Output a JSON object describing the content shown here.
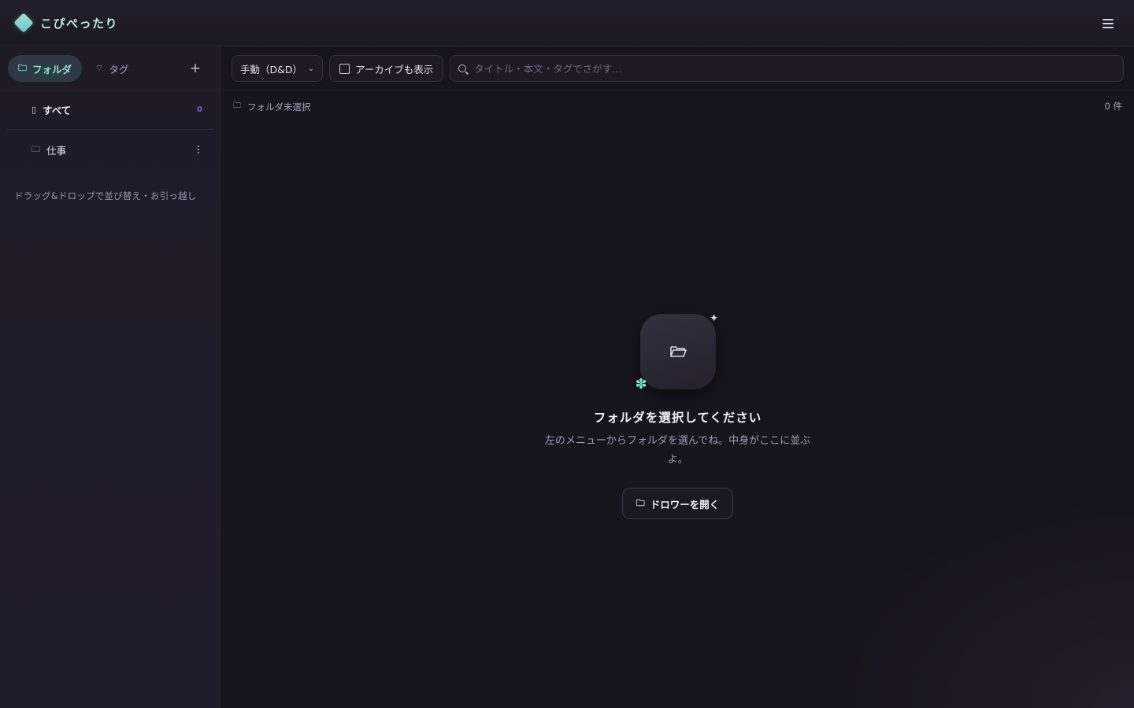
{
  "app": {
    "title": "こぴぺったり"
  },
  "sidebar": {
    "tabs": [
      {
        "label": "フォルダ",
        "icon": "folder-icon"
      },
      {
        "label": "タグ",
        "icon": "tag-icon"
      }
    ],
    "add_icon": "+",
    "folders": [
      {
        "label": "すべて",
        "count": "0",
        "icon": "clipboard-icon"
      },
      {
        "label": "仕事",
        "icon": "folder-icon"
      }
    ],
    "hint": "ドラッグ&ドロップで並び替え・お引っ越し"
  },
  "toolbar": {
    "sort_label": "手動（D&D）",
    "archive_label": "アーカイブも表示",
    "search_placeholder": "タイトル・本文・タグでさがす…"
  },
  "main": {
    "breadcrumb": "フォルダ未選択",
    "count": "0 件",
    "empty_title": "フォルダを選択してください",
    "empty_desc": "左のメニューからフォルダを選んでね。中身がここに並ぶよ。",
    "open_drawer_label": "ドロワーを開く"
  },
  "colors": {
    "accent": "#8fe0c8",
    "background": "#16141d",
    "sidebar": "#1e1b27",
    "count_badge": "#7b5fc9"
  }
}
